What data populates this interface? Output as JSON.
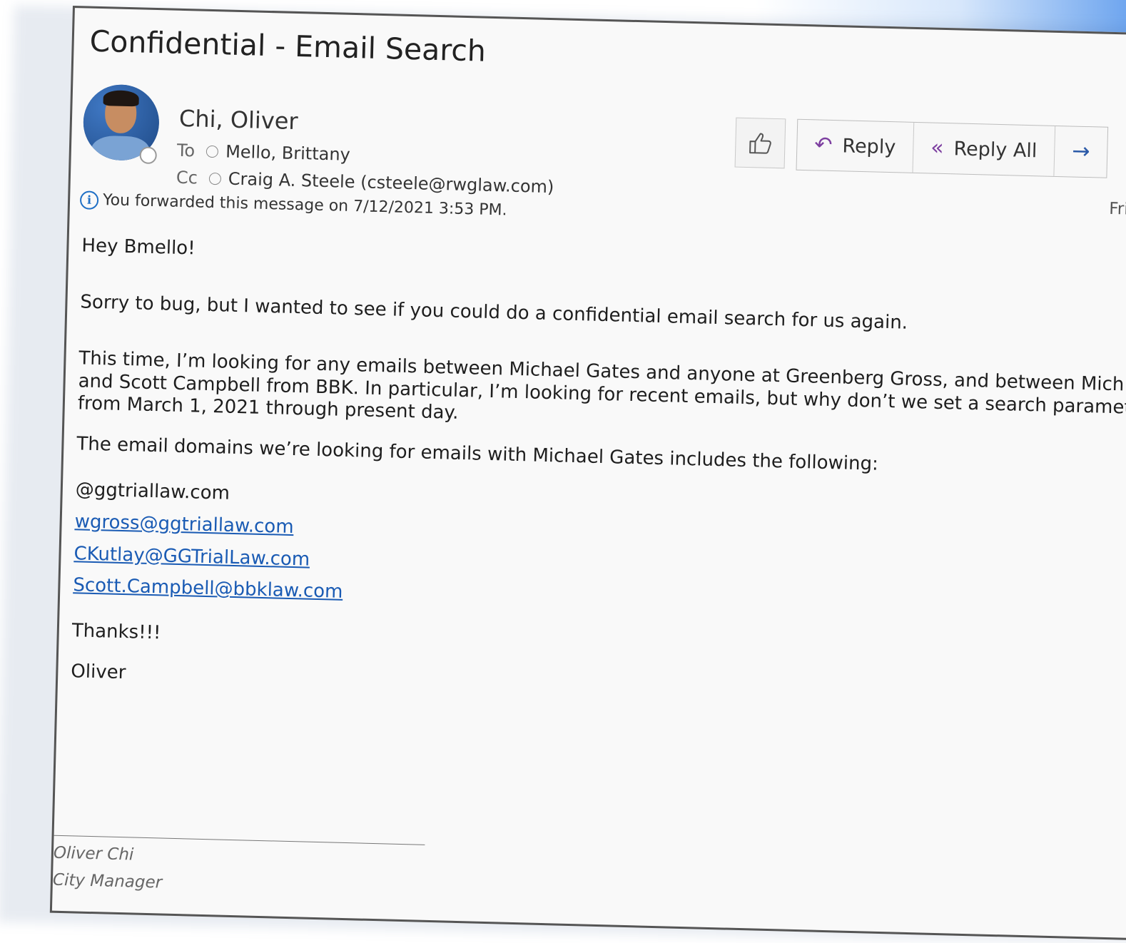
{
  "email": {
    "subject": "Confidential - Email Search",
    "sender": "Chi, Oliver",
    "to_label": "To",
    "to_name": "Mello, Brittany",
    "cc_label": "Cc",
    "cc_name": "Craig A. Steele (csteele@rwglaw.com)",
    "info_text": "You forwarded this message on 7/12/2021 3:53 PM.",
    "date_partial": "Fri"
  },
  "toolbar": {
    "reply_label": "Reply",
    "reply_all_label": "Reply All"
  },
  "body": {
    "greeting": "Hey Bmello!",
    "para1": "Sorry to bug, but I wanted to see if you could do a confidential email search for us again.",
    "para2_line1": "This time, I’m looking for any emails between Michael Gates and anyone at Greenberg Gross, and between Mich",
    "para2_line2": "and Scott Campbell from BBK. In particular, I’m looking for recent emails, but why don’t we set a search paramet",
    "para2_line3": "from March 1, 2021 through present day.",
    "para3": "The email domains we’re looking for emails with Michael Gates includes the following:",
    "domains": [
      "@ggtriallaw.com",
      "wgross@ggtriallaw.com",
      "CKutlay@GGTrialLaw.com",
      "Scott.Campbell@bbklaw.com"
    ],
    "thanks": "Thanks!!!",
    "signoff": "Oliver"
  },
  "signature": {
    "name": "Oliver Chi",
    "title": "City Manager"
  },
  "icons": [
    "like-icon",
    "reply-icon",
    "reply-all-icon",
    "forward-icon",
    "info-icon",
    "presence-icon"
  ],
  "colors": {
    "link": "#1a5bb4",
    "reply_icon": "#7d3fa0",
    "info": "#1f6fc5",
    "border": "#555555"
  }
}
